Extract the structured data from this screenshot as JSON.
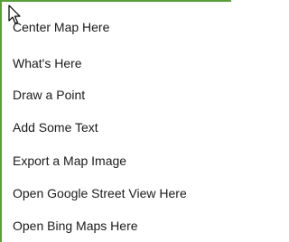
{
  "context_menu": {
    "items": [
      {
        "label": "Center Map Here"
      },
      {
        "label": "What's Here"
      },
      {
        "label": "Draw a Point"
      },
      {
        "label": "Add Some Text"
      },
      {
        "label": "Export a Map Image"
      },
      {
        "label": "Open Google Street View Here"
      },
      {
        "label": "Open Bing Maps Here"
      }
    ]
  },
  "colors": {
    "border": "#5a9e3a",
    "background": "#ffffff",
    "text": "#1a1a1a"
  },
  "icons": {
    "cursor": "mouse-pointer-icon"
  }
}
